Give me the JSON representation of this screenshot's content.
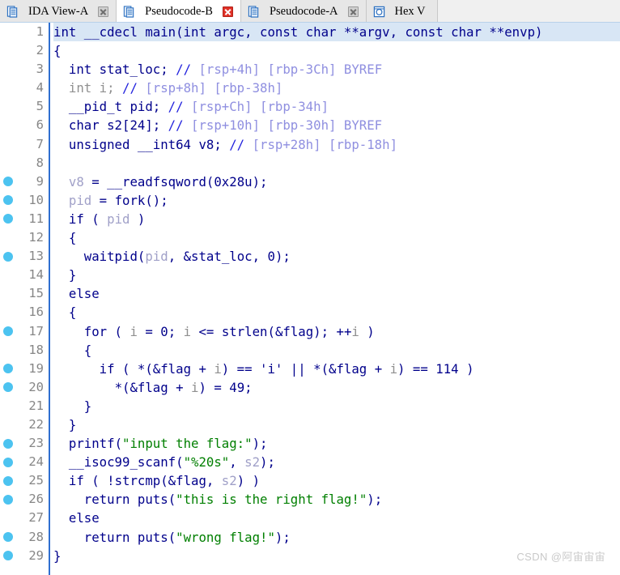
{
  "window": {
    "app": "IDA Pro",
    "watermark": "CSDN @阿宙宙宙"
  },
  "tabs": [
    {
      "label": "IDA View-A",
      "icon": "document-icon",
      "active": false,
      "close_icon": "close-icon",
      "close_style": "grey"
    },
    {
      "label": "Pseudocode-B",
      "icon": "document-icon",
      "active": true,
      "close_icon": "close-icon-red",
      "close_style": "red"
    },
    {
      "label": "Pseudocode-A",
      "icon": "document-icon",
      "active": false,
      "close_icon": "close-icon",
      "close_style": "grey"
    },
    {
      "label": "Hex V",
      "icon": "hexview-icon",
      "active": false,
      "close_icon": "",
      "close_style": ""
    }
  ],
  "editor": {
    "first_line_highlight_color": "#d8e6f5",
    "breakpoint_dot_color": "#4cc3f0",
    "gutter_separator_color": "#2f6fd0",
    "lines": [
      {
        "n": 1,
        "dot": false,
        "html": "<span class=\"t-kw\">int __cdecl main(int argc, const char **argv, const char **envp)</span>",
        "highlight": true
      },
      {
        "n": 2,
        "dot": false,
        "html": "<span class=\"t-kw\">{</span>"
      },
      {
        "n": 3,
        "dot": false,
        "html": "<span class=\"t-kw\">  int stat_loc; </span><span class=\"t-cmtm\">//</span><span class=\"t-cmt\"> [rsp+4h] [rbp-3Ch] BYREF</span>"
      },
      {
        "n": 4,
        "dot": false,
        "html": "<span class=\"t-dim\">  int i; </span><span class=\"t-cmtm\">//</span><span class=\"t-cmt\"> [rsp+8h] [rbp-38h]</span>"
      },
      {
        "n": 5,
        "dot": false,
        "html": "<span class=\"t-kw\">  __pid_t pid; </span><span class=\"t-cmtm\">//</span><span class=\"t-cmt\"> [rsp+Ch] [rbp-34h]</span>"
      },
      {
        "n": 6,
        "dot": false,
        "html": "<span class=\"t-kw\">  char s2[24]; </span><span class=\"t-cmtm\">//</span><span class=\"t-cmt\"> [rsp+10h] [rbp-30h] BYREF</span>"
      },
      {
        "n": 7,
        "dot": false,
        "html": "<span class=\"t-kw\">  unsigned __int64 v8; </span><span class=\"t-cmtm\">//</span><span class=\"t-cmt\"> [rsp+28h] [rbp-18h]</span>"
      },
      {
        "n": 8,
        "dot": false,
        "html": ""
      },
      {
        "n": 9,
        "dot": true,
        "html": "  <span class=\"t-var\">v8</span><span class=\"t-kw\"> = </span><span class=\"t-fn\">__readfsqword</span><span class=\"t-kw\">(</span><span class=\"t-num\">0x28u</span><span class=\"t-kw\">);</span>"
      },
      {
        "n": 10,
        "dot": true,
        "html": "  <span class=\"t-var\">pid</span><span class=\"t-kw\"> = </span><span class=\"t-fn\">fork</span><span class=\"t-kw\">();</span>"
      },
      {
        "n": 11,
        "dot": true,
        "html": "  <span class=\"t-kw\">if ( </span><span class=\"t-var\">pid</span><span class=\"t-kw\"> )</span>"
      },
      {
        "n": 12,
        "dot": false,
        "html": "  <span class=\"t-kw\">{</span>"
      },
      {
        "n": 13,
        "dot": true,
        "html": "    <span class=\"t-fn\">waitpid</span><span class=\"t-kw\">(</span><span class=\"t-var\">pid</span><span class=\"t-kw\">, &amp;</span><span class=\"t-kw\">stat_loc</span><span class=\"t-kw\">, </span><span class=\"t-num\">0</span><span class=\"t-kw\">);</span>"
      },
      {
        "n": 14,
        "dot": false,
        "html": "  <span class=\"t-kw\">}</span>"
      },
      {
        "n": 15,
        "dot": false,
        "html": "  <span class=\"t-kw\">else</span>"
      },
      {
        "n": 16,
        "dot": false,
        "html": "  <span class=\"t-kw\">{</span>"
      },
      {
        "n": 17,
        "dot": true,
        "html": "    <span class=\"t-kw\">for ( </span><span class=\"t-dim\">i</span><span class=\"t-kw\"> = </span><span class=\"t-num\">0</span><span class=\"t-kw\">; </span><span class=\"t-dim\">i</span><span class=\"t-kw\"> &lt;= </span><span class=\"t-fn\">strlen</span><span class=\"t-kw\">(&amp;flag); ++</span><span class=\"t-dim\">i</span><span class=\"t-kw\"> )</span>"
      },
      {
        "n": 18,
        "dot": false,
        "html": "    <span class=\"t-kw\">{</span>"
      },
      {
        "n": 19,
        "dot": true,
        "html": "      <span class=\"t-kw\">if ( *(&amp;flag + </span><span class=\"t-dim\">i</span><span class=\"t-kw\">) == 'i' || *(&amp;flag + </span><span class=\"t-dim\">i</span><span class=\"t-kw\">) == </span><span class=\"t-num\">114</span><span class=\"t-kw\"> )</span>"
      },
      {
        "n": 20,
        "dot": true,
        "html": "        <span class=\"t-kw\">*(&amp;flag + </span><span class=\"t-dim\">i</span><span class=\"t-kw\">) = </span><span class=\"t-num\">49</span><span class=\"t-kw\">;</span>"
      },
      {
        "n": 21,
        "dot": false,
        "html": "    <span class=\"t-kw\">}</span>"
      },
      {
        "n": 22,
        "dot": false,
        "html": "  <span class=\"t-kw\">}</span>"
      },
      {
        "n": 23,
        "dot": true,
        "html": "  <span class=\"t-fn\">printf</span><span class=\"t-kw\">(</span><span class=\"t-str\">\"input the flag:\"</span><span class=\"t-kw\">);</span>"
      },
      {
        "n": 24,
        "dot": true,
        "html": "  <span class=\"t-fn\">__isoc99_scanf</span><span class=\"t-kw\">(</span><span class=\"t-str\">\"%20s\"</span><span class=\"t-kw\">, </span><span class=\"t-var\">s2</span><span class=\"t-kw\">);</span>"
      },
      {
        "n": 25,
        "dot": true,
        "html": "  <span class=\"t-kw\">if ( !</span><span class=\"t-fn\">strcmp</span><span class=\"t-kw\">(&amp;flag, </span><span class=\"t-var\">s2</span><span class=\"t-kw\">) )</span>"
      },
      {
        "n": 26,
        "dot": true,
        "html": "    <span class=\"t-kw\">return </span><span class=\"t-fn\">puts</span><span class=\"t-kw\">(</span><span class=\"t-str\">\"this is the right flag!\"</span><span class=\"t-kw\">);</span>"
      },
      {
        "n": 27,
        "dot": false,
        "html": "  <span class=\"t-kw\">else</span>"
      },
      {
        "n": 28,
        "dot": true,
        "html": "    <span class=\"t-kw\">return </span><span class=\"t-fn\">puts</span><span class=\"t-kw\">(</span><span class=\"t-str\">\"wrong flag!\"</span><span class=\"t-kw\">);</span>"
      },
      {
        "n": 29,
        "dot": true,
        "html": "<span class=\"t-kw\">}</span>"
      }
    ]
  }
}
